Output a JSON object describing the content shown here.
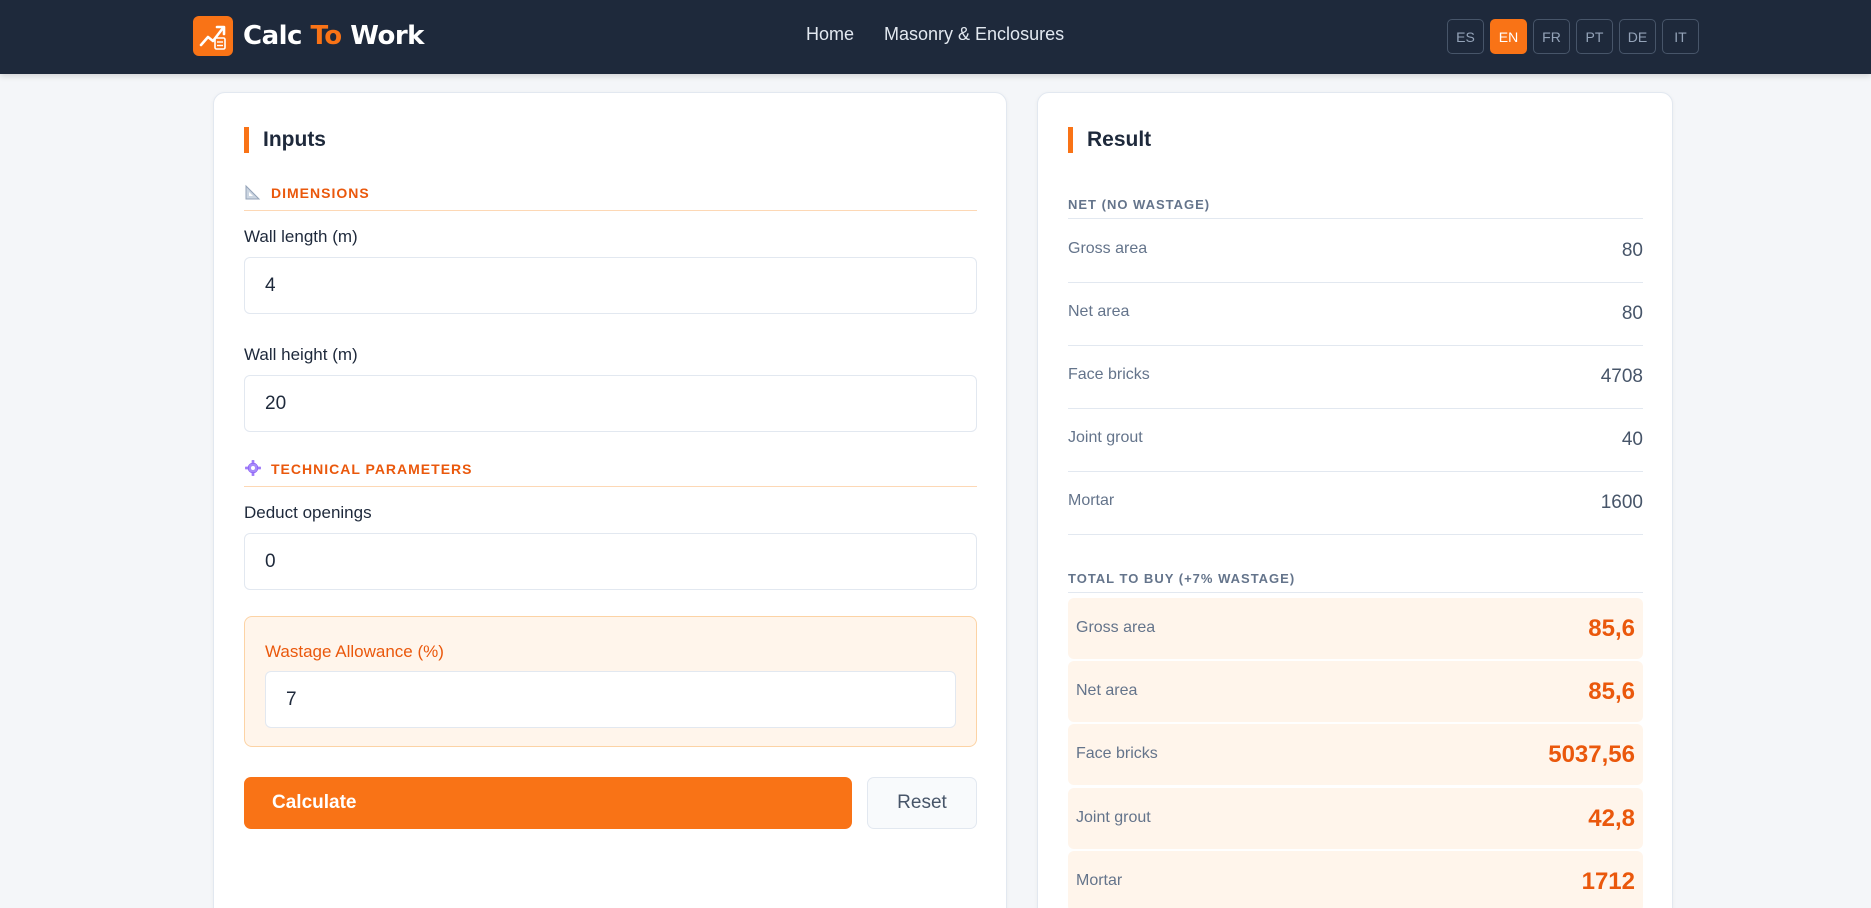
{
  "brand": {
    "name_part1": "Calc ",
    "name_accent": "To",
    "name_part2": " Work",
    "accent_color": "#f97316",
    "header_bg": "#1e293b"
  },
  "nav": {
    "home": "Home",
    "masonry": "Masonry & Enclosures"
  },
  "languages": [
    {
      "code": "ES",
      "active": false
    },
    {
      "code": "EN",
      "active": true
    },
    {
      "code": "FR",
      "active": false
    },
    {
      "code": "PT",
      "active": false
    },
    {
      "code": "DE",
      "active": false
    },
    {
      "code": "IT",
      "active": false
    }
  ],
  "inputs": {
    "title": "Inputs",
    "dimensions_section": {
      "label": "DIMENSIONS",
      "icon": "triangle-ruler-icon"
    },
    "wall_length": {
      "label": "Wall length (m)",
      "value": "4"
    },
    "wall_height": {
      "label": "Wall height (m)",
      "value": "20"
    },
    "technical_section": {
      "label": "TECHNICAL PARAMETERS",
      "icon": "gear-icon"
    },
    "deduct_openings": {
      "label": "Deduct openings",
      "value": "0"
    },
    "wastage": {
      "label": "Wastage Allowance (%)",
      "value": "7"
    },
    "calculate_label": "Calculate",
    "reset_label": "Reset"
  },
  "result": {
    "title": "Result",
    "net_section": "NET (NO WASTAGE)",
    "net_rows": [
      {
        "label": "Gross area",
        "value": "80"
      },
      {
        "label": "Net area",
        "value": "80"
      },
      {
        "label": "Face bricks",
        "value": "4708"
      },
      {
        "label": "Joint grout",
        "value": "40"
      },
      {
        "label": "Mortar",
        "value": "1600"
      }
    ],
    "total_section": "TOTAL TO BUY (+7% WASTAGE)",
    "total_rows": [
      {
        "label": "Gross area",
        "value": "85,6"
      },
      {
        "label": "Net area",
        "value": "85,6"
      },
      {
        "label": "Face bricks",
        "value": "5037,56"
      },
      {
        "label": "Joint grout",
        "value": "42,8"
      },
      {
        "label": "Mortar",
        "value": "1712"
      }
    ]
  }
}
